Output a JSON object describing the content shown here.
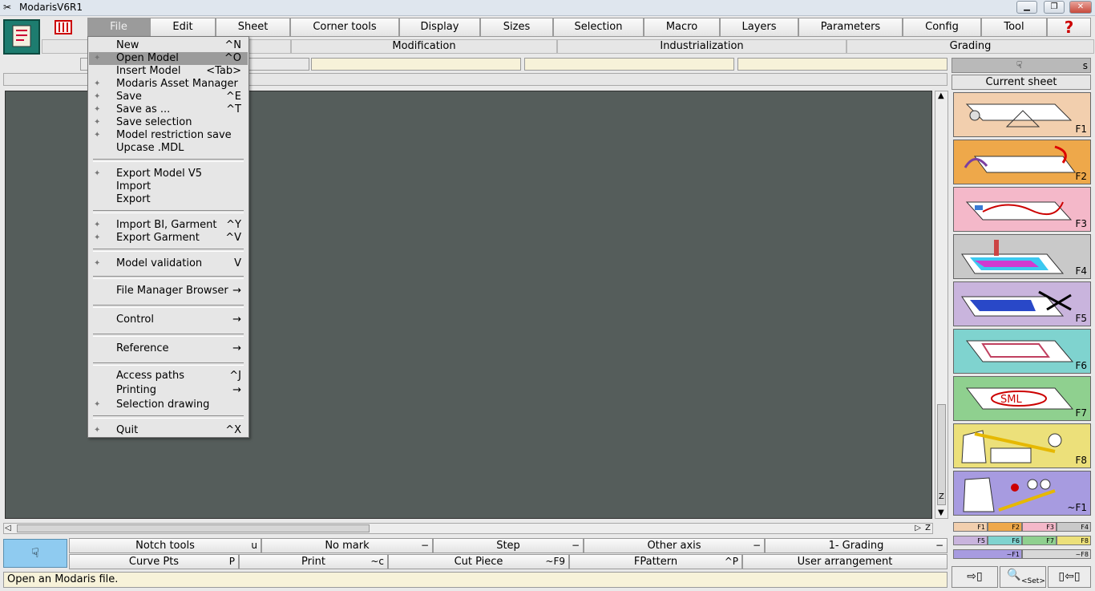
{
  "window": {
    "title": "ModarisV6R1"
  },
  "menubar": [
    "File",
    "Edit",
    "Sheet",
    "Corner tools",
    "Display",
    "Sizes",
    "Selection",
    "Macro",
    "Layers",
    "Parameters",
    "Config",
    "Tool"
  ],
  "help_glyph": "?",
  "toolbar_row2": {
    "modification": "Modification",
    "industrialization": "Industrialization",
    "grading": "Grading"
  },
  "right_panel": {
    "header_s": "s",
    "current_sheet": "Current sheet",
    "tiles": [
      {
        "key": "F1"
      },
      {
        "key": "F2"
      },
      {
        "key": "F3"
      },
      {
        "key": "F4"
      },
      {
        "key": "F5"
      },
      {
        "key": "F6"
      },
      {
        "key": "F7"
      },
      {
        "key": "F8"
      },
      {
        "key": "~F1"
      }
    ],
    "mini_keys_row1": [
      "F1",
      "F2",
      "F3",
      "F4"
    ],
    "mini_keys_row2": [
      "F5",
      "F6",
      "F7",
      "F8"
    ],
    "mini_keys_row3": [
      "~F1",
      "~F8"
    ],
    "bottom_zoom_label": "<Set>"
  },
  "file_menu": [
    {
      "label": "New",
      "shortcut": "^N",
      "bullet": false,
      "selected": false
    },
    {
      "label": "Open Model",
      "shortcut": "^O",
      "bullet": true,
      "selected": true
    },
    {
      "label": "Insert Model",
      "shortcut": "<Tab>",
      "bullet": false,
      "selected": false
    },
    {
      "label": "Modaris Asset Manager",
      "shortcut": "",
      "bullet": true,
      "selected": false
    },
    {
      "label": "Save",
      "shortcut": "^E",
      "bullet": true,
      "selected": false
    },
    {
      "label": "Save as ...",
      "shortcut": "^T",
      "bullet": true,
      "selected": false
    },
    {
      "label": "Save selection",
      "shortcut": "",
      "bullet": true,
      "selected": false
    },
    {
      "label": "Model restriction save",
      "shortcut": "",
      "bullet": true,
      "selected": false
    },
    {
      "label": "Upcase .MDL",
      "shortcut": "",
      "bullet": false,
      "selected": false
    },
    {
      "label": "Export Model V5",
      "shortcut": "",
      "bullet": true,
      "selected": false
    },
    {
      "label": "Import",
      "shortcut": "",
      "bullet": false,
      "selected": false
    },
    {
      "label": "Export",
      "shortcut": "",
      "bullet": false,
      "selected": false
    },
    {
      "label": "Import BI, Garment",
      "shortcut": "^Y",
      "bullet": true,
      "selected": false
    },
    {
      "label": "Export Garment",
      "shortcut": "^V",
      "bullet": true,
      "selected": false
    },
    {
      "label": "Model validation",
      "shortcut": "V",
      "bullet": true,
      "selected": false
    },
    {
      "label": "File Manager Browser",
      "shortcut": "→",
      "bullet": false,
      "selected": false
    },
    {
      "label": "Control",
      "shortcut": "→",
      "bullet": false,
      "selected": false
    },
    {
      "label": "Reference",
      "shortcut": "→",
      "bullet": false,
      "selected": false
    },
    {
      "label": "Access paths",
      "shortcut": "^J",
      "bullet": false,
      "selected": false
    },
    {
      "label": "Printing",
      "shortcut": "→",
      "bullet": false,
      "selected": false
    },
    {
      "label": "Selection drawing",
      "shortcut": "",
      "bullet": true,
      "selected": false
    },
    {
      "label": "Quit",
      "shortcut": "^X",
      "bullet": true,
      "selected": false
    }
  ],
  "bottom_row1": [
    {
      "label": "Notch tools",
      "shortcut": "u"
    },
    {
      "label": "No mark",
      "shortcut": "−"
    },
    {
      "label": "Step",
      "shortcut": "−"
    },
    {
      "label": "Other axis",
      "shortcut": "−"
    },
    {
      "label": "1- Grading",
      "shortcut": "−"
    }
  ],
  "bottom_row2": [
    {
      "label": "Curve Pts",
      "shortcut": "P"
    },
    {
      "label": "Print",
      "shortcut": "~c"
    },
    {
      "label": "Cut Piece",
      "shortcut": "~F9"
    },
    {
      "label": "FPattern",
      "shortcut": "^P"
    },
    {
      "label": "User arrangement",
      "shortcut": ""
    }
  ],
  "status": {
    "text": "Open an Modaris file."
  },
  "colors": {
    "workspace": "#555d5b",
    "tile_f1": "#f2cfae",
    "tile_f2": "#eea84a",
    "tile_f3": "#f4b8c9",
    "tile_f4": "#c9c9c9",
    "tile_f5": "#c9b4dd",
    "tile_f6": "#7fd3cf",
    "tile_f7": "#8fd08f",
    "tile_f8": "#ece07a",
    "tile_f9": "#a79be0"
  }
}
